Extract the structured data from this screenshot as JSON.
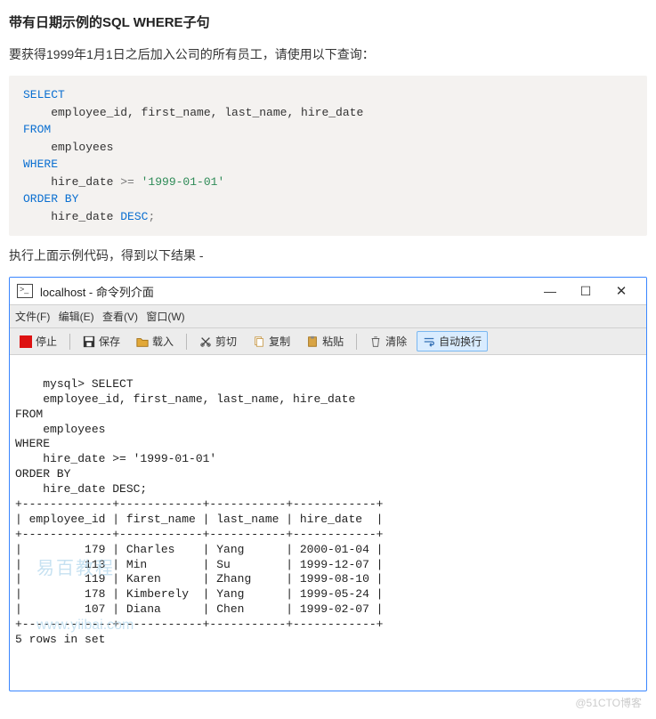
{
  "page": {
    "heading": "带有日期示例的SQL WHERE子句",
    "desc": "要获得1999年1月1日之后加入公司的所有员工，请使用以下查询：",
    "result_intro": "执行上面示例代码，得到以下结果 -"
  },
  "sql": {
    "kw_select": "SELECT",
    "columns": "    employee_id, first_name, last_name, hire_date",
    "kw_from": "FROM",
    "table": "    employees",
    "kw_where": "WHERE",
    "cond_a": "    hire_date ",
    "cond_op": ">=",
    "cond_b": " '1999-01-01'",
    "kw_order": "ORDER BY",
    "order_col": "    hire_date ",
    "kw_desc": "DESC",
    "semi": ";"
  },
  "window": {
    "title": "localhost - 命令列介面",
    "menus": {
      "file": "文件(F)",
      "edit": "编辑(E)",
      "view": "查看(V)",
      "window": "窗口(W)"
    },
    "toolbar": {
      "stop": "停止",
      "save": "保存",
      "load": "载入",
      "cut": "剪切",
      "copy": "复制",
      "paste": "粘贴",
      "clear": "清除",
      "wrap": "自动换行"
    }
  },
  "terminal_text": "mysql> SELECT\n    employee_id, first_name, last_name, hire_date\nFROM\n    employees\nWHERE\n    hire_date >= '1999-01-01'\nORDER BY\n    hire_date DESC;\n+-------------+------------+-----------+------------+\n| employee_id | first_name | last_name | hire_date  |\n+-------------+------------+-----------+------------+\n|         179 | Charles    | Yang      | 2000-01-04 |\n|         113 | Min        | Su        | 1999-12-07 |\n|         119 | Karen      | Zhang     | 1999-08-10 |\n|         178 | Kimberely  | Yang      | 1999-05-24 |\n|         107 | Diana      | Chen      | 1999-02-07 |\n+-------------+------------+-----------+------------+\n5 rows in set",
  "chart_data": {
    "type": "table",
    "title": "Query result",
    "columns": [
      "employee_id",
      "first_name",
      "last_name",
      "hire_date"
    ],
    "rows": [
      [
        179,
        "Charles",
        "Yang",
        "2000-01-04"
      ],
      [
        113,
        "Min",
        "Su",
        "1999-12-07"
      ],
      [
        119,
        "Karen",
        "Zhang",
        "1999-08-10"
      ],
      [
        178,
        "Kimberely",
        "Yang",
        "1999-05-24"
      ],
      [
        107,
        "Diana",
        "Chen",
        "1999-02-07"
      ]
    ],
    "row_count_text": "5 rows in set"
  },
  "watermark": {
    "line1": "易百教程",
    "line2": "www.yiibai.com"
  },
  "footer": "@51CTO博客"
}
